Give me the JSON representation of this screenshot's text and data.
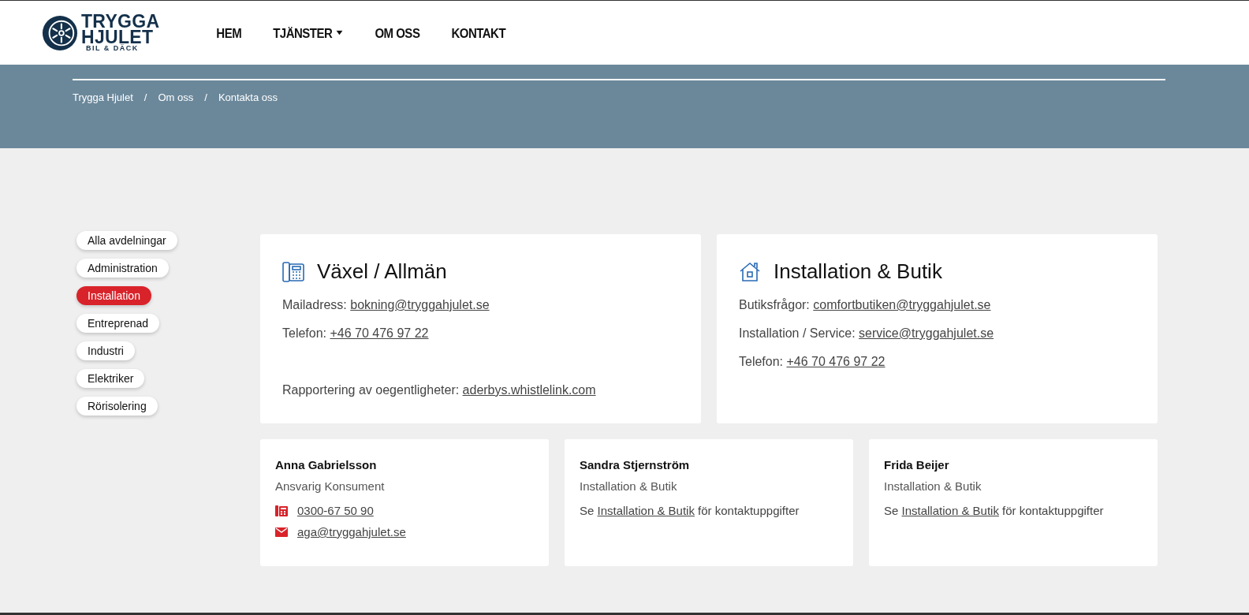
{
  "header": {
    "logo": {
      "line1": "TRYGGA",
      "line2": "HJULET",
      "tagline": "BIL & DÄCK"
    },
    "nav": [
      {
        "label": "HEM",
        "dropdown": false
      },
      {
        "label": "TJÄNSTER",
        "dropdown": true
      },
      {
        "label": "OM OSS",
        "dropdown": false
      },
      {
        "label": "KONTAKT",
        "dropdown": false
      }
    ]
  },
  "breadcrumb": [
    {
      "label": "Trygga Hjulet"
    },
    {
      "separator": "/",
      "label": "Om oss"
    },
    {
      "separator": "/",
      "label": "Kontakta oss"
    }
  ],
  "filters": [
    {
      "label": "Alla avdelningar",
      "selected": false
    },
    {
      "label": "Administration",
      "selected": false
    },
    {
      "label": "Installation",
      "selected": true
    },
    {
      "label": "Entreprenad",
      "selected": false
    },
    {
      "label": "Industri",
      "selected": false
    },
    {
      "label": "Elektriker",
      "selected": false
    },
    {
      "label": "Rörisolering",
      "selected": false
    }
  ],
  "info_cards": [
    {
      "title": "Växel / Allmän",
      "lines": [
        {
          "label": "Mailadress:",
          "link": "bokning@tryggahjulet.se",
          "gap_before": false
        },
        {
          "label": "Telefon:",
          "link": "+46 70 476 97 22",
          "gap_before": false
        },
        {
          "label": "Rapportering av oegentligheter:",
          "link": "aderbys.whistlelink.com",
          "gap_before": true
        }
      ]
    },
    {
      "title": "Installation & Butik",
      "lines": [
        {
          "label": "Butiksfrågor:",
          "link": "comfortbutiken@tryggahjulet.se",
          "gap_before": false
        },
        {
          "label": "Installation / Service:",
          "link": "service@tryggahjulet.se",
          "gap_before": false
        },
        {
          "label": "Telefon:",
          "link": "+46 70 476 97 22",
          "gap_before": false
        }
      ]
    }
  ],
  "people": [
    {
      "name": "Anna Gabrielsson",
      "role": "Ansvarig Konsument",
      "contacts": [
        {
          "kind": "phone",
          "text": "0300-67 50 90"
        },
        {
          "kind": "email",
          "text": "aga@tryggahjulet.se"
        }
      ]
    },
    {
      "name": "Sandra Stjernström",
      "role": "Installation & Butik",
      "note": {
        "before": "Se",
        "link": "Installation & Butik",
        "after": "för kontaktuppgifter"
      }
    },
    {
      "name": "Frida Beijer",
      "role": "Installation & Butik",
      "note": {
        "before": "Se",
        "link": "Installation & Butik",
        "after": "för kontaktuppgifter"
      }
    }
  ]
}
